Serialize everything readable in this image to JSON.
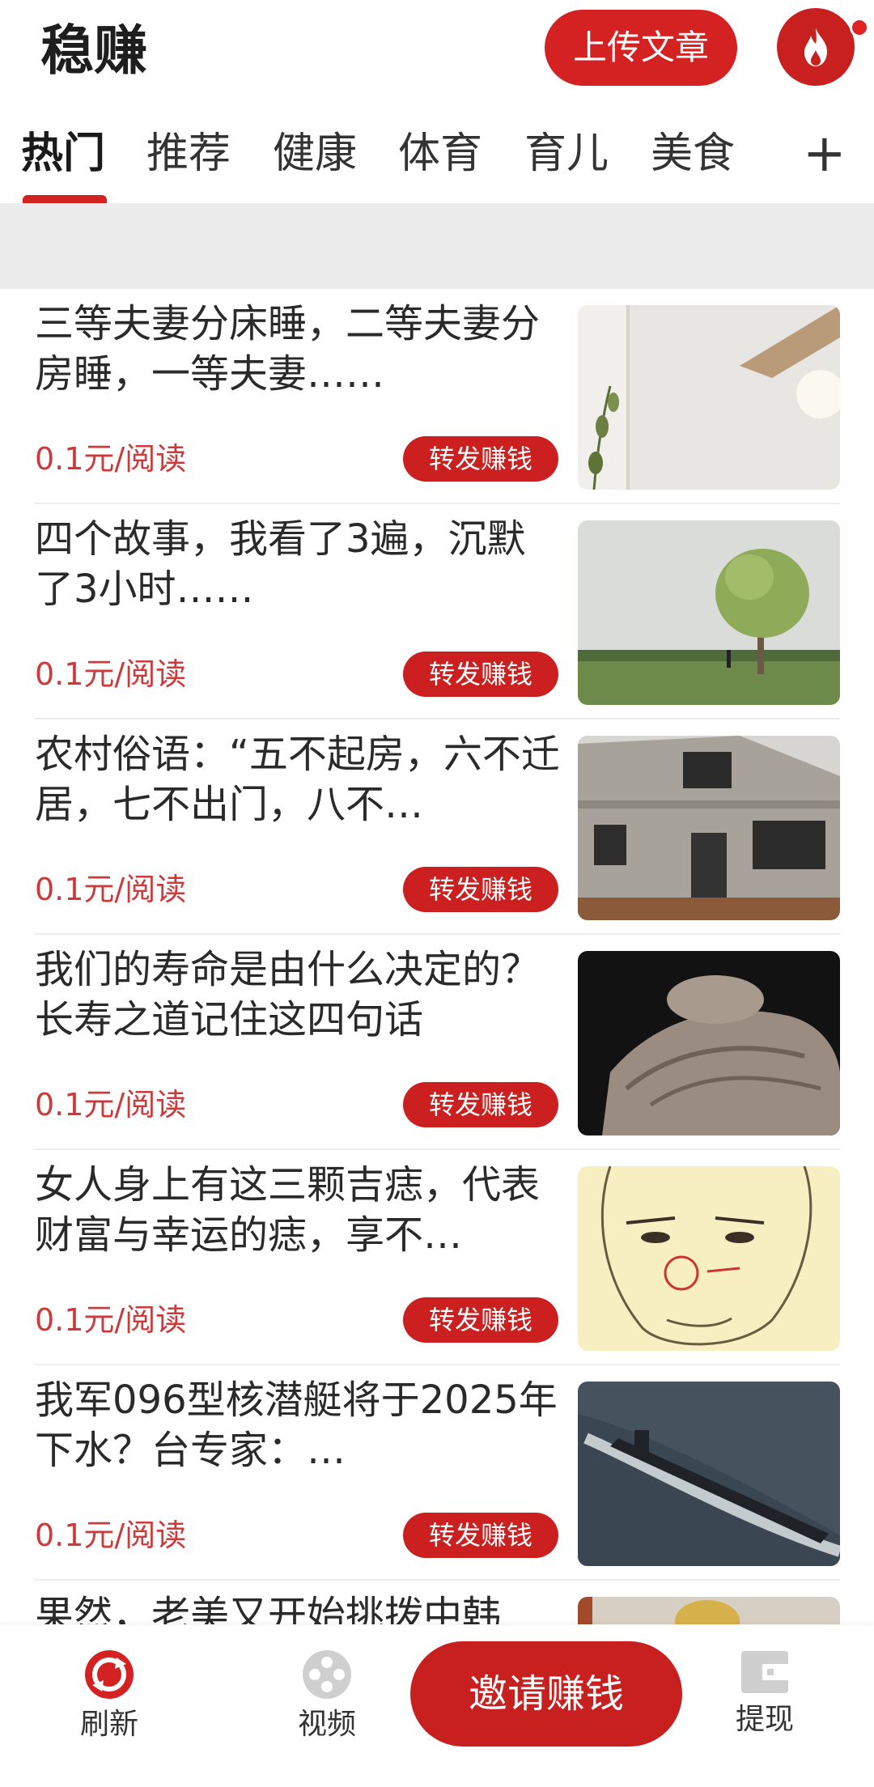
{
  "header": {
    "app_title": "稳赚",
    "upload_label": "上传文章",
    "accent_color": "#d42222"
  },
  "tabs": [
    {
      "label": "热门",
      "active": true
    },
    {
      "label": "推荐",
      "active": false
    },
    {
      "label": "健康",
      "active": false
    },
    {
      "label": "体育",
      "active": false
    },
    {
      "label": "育儿",
      "active": false
    },
    {
      "label": "美食",
      "active": false
    }
  ],
  "tab_add_label": "+",
  "articles": [
    {
      "title": "三等夫妻分床睡，二等夫妻分房睡，一等夫妻……",
      "price": "0.1元/阅读",
      "action": "转发赚钱",
      "thumb": "lamp-and-plant-photo"
    },
    {
      "title": "四个故事，我看了3遍，沉默了3小时……",
      "price": "0.1元/阅读",
      "action": "转发赚钱",
      "thumb": "tree-in-field-photo"
    },
    {
      "title": "农村俗语：“五不起房，六不迁居，七不出门，八不…",
      "price": "0.1元/阅读",
      "action": "转发赚钱",
      "thumb": "concrete-house-photo"
    },
    {
      "title": "我们的寿命是由什么决定的？长寿之道记住这四句话",
      "price": "0.1元/阅读",
      "action": "转发赚钱",
      "thumb": "elderly-hands-photo"
    },
    {
      "title": "女人身上有这三颗吉痣，代表财富与幸运的痣，享不…",
      "price": "0.1元/阅读",
      "action": "转发赚钱",
      "thumb": "face-sketch-photo"
    },
    {
      "title": "我军096型核潜艇将于2025年下水？台专家：…",
      "price": "0.1元/阅读",
      "action": "转发赚钱",
      "thumb": "submarine-photo"
    },
    {
      "title": "果然，老美又开始挑拨中韩",
      "price": "",
      "action": "",
      "thumb": "partial-photo"
    }
  ],
  "bottom_nav": {
    "refresh_label": "刷新",
    "video_label": "视频",
    "invite_label": "邀请赚钱",
    "withdraw_label": "提现"
  }
}
